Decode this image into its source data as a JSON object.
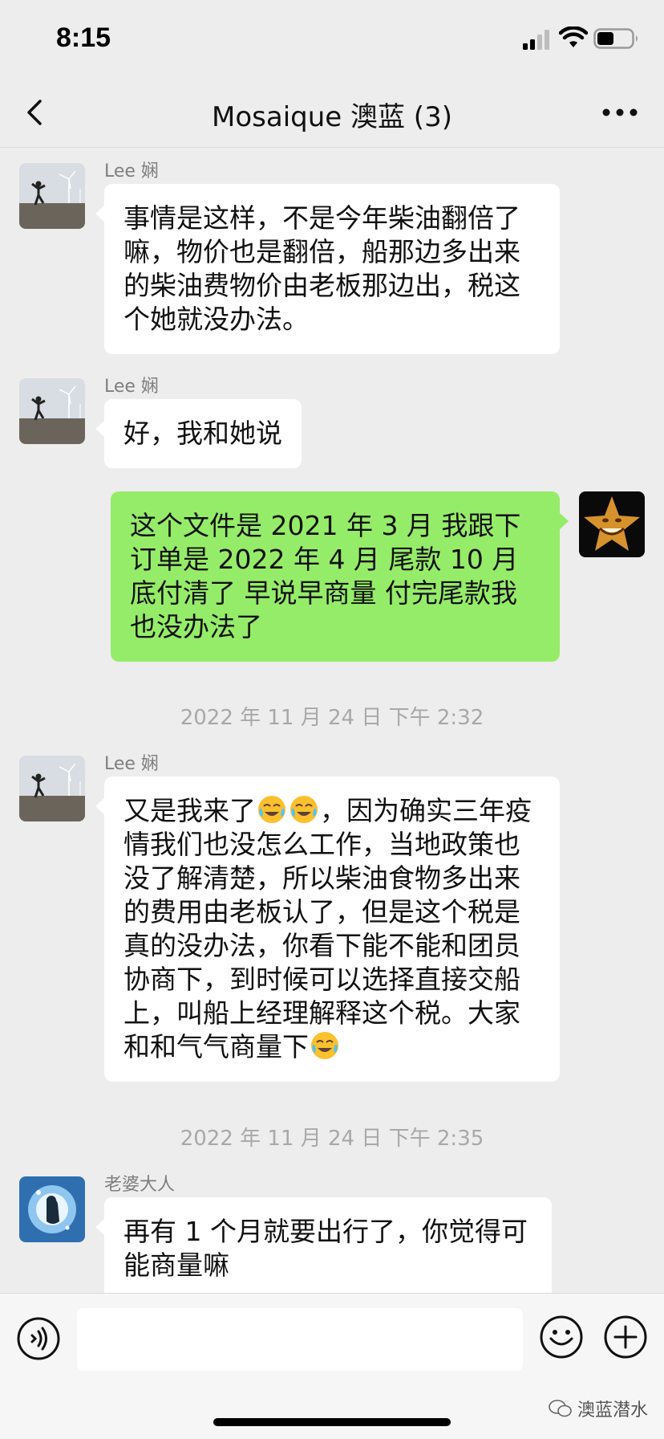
{
  "status": {
    "time": "8:15"
  },
  "nav": {
    "title": "Mosaique 澳蓝 (3)"
  },
  "messages": [
    {
      "sender": "Lee 娴",
      "text": "事情是这样，不是今年柴油翻倍了嘛，物价也是翻倍，船那边多出来的柴油费物价由老板那边出，税这个她就没办法。"
    },
    {
      "sender": "Lee 娴",
      "text": "好，我和她说"
    },
    {
      "text": "这个文件是 2021 年 3 月 我跟下订单是 2022 年 4 月 尾款 10 月底付清了 早说早商量 付完尾款我也没办法了"
    },
    {
      "timestamp": "2022 年 11 月 24 日 下午 2:32"
    },
    {
      "sender": "Lee 娴",
      "text_a": "又是我来了",
      "text_b": "，因为确实三年疫情我们也没怎么工作，当地政策也没了解清楚，所以柴油食物多出来的费用由老板认了，但是这个税是真的没办法，你看下能不能和团员协商下，到时候可以选择直接交船上，叫船上经理解释这个税。大家和和气气商量下"
    },
    {
      "timestamp": "2022 年 11 月 24 日 下午 2:35"
    },
    {
      "sender": "老婆大人",
      "text": "再有 1 个月就要出行了，你觉得可能商量嘛"
    }
  ],
  "watermark": "澳蓝潜水",
  "colors": {
    "background": "#ededed",
    "incoming_bubble": "#ffffff",
    "outgoing_bubble": "#95ec69"
  }
}
